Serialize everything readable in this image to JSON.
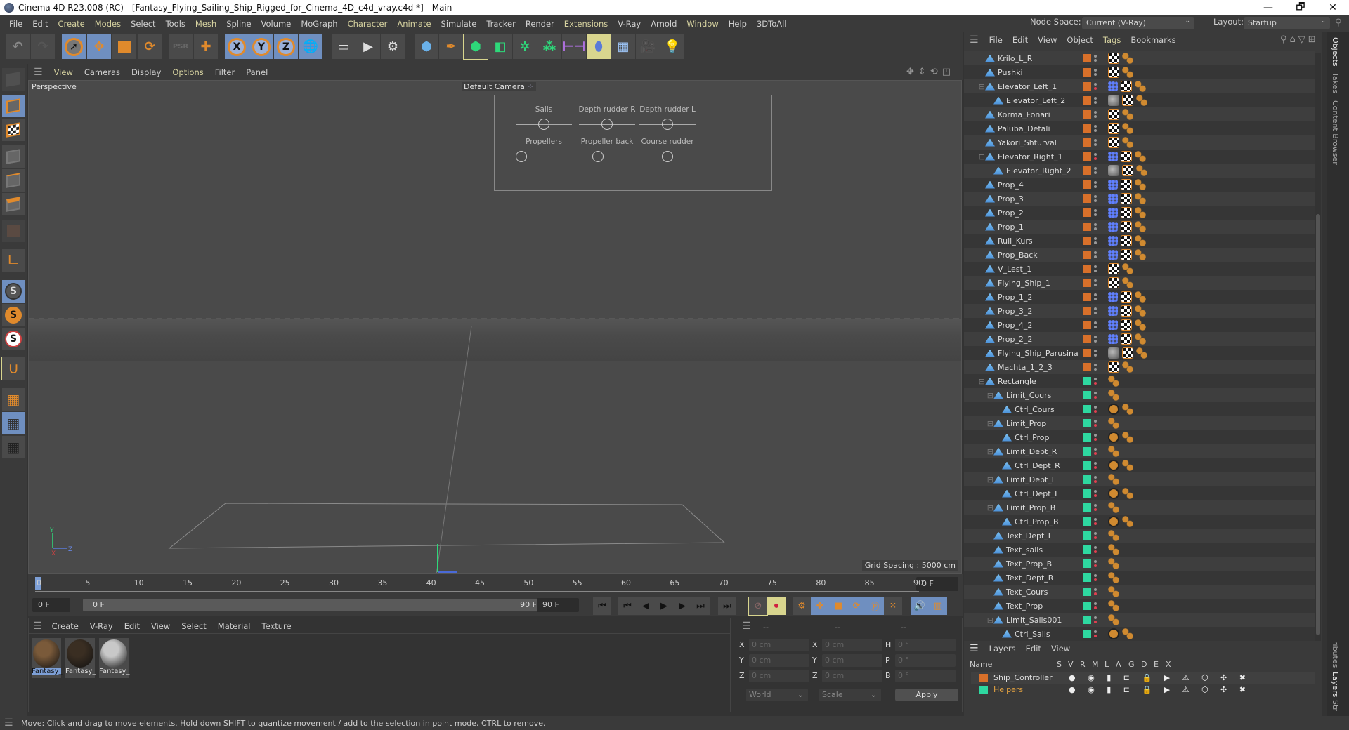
{
  "window": {
    "title": "Cinema 4D R23.008 (RC) - [Fantasy_Flying_Sailing_Ship_Rigged_for_Cinema_4D_c4d_vray.c4d *] - Main",
    "controls": [
      "—",
      "🗗",
      "✕"
    ]
  },
  "menubar": {
    "items": [
      {
        "label": "File",
        "hl": false
      },
      {
        "label": "Edit",
        "hl": false
      },
      {
        "label": "Create",
        "hl": true
      },
      {
        "label": "Modes",
        "hl": true
      },
      {
        "label": "Select",
        "hl": false
      },
      {
        "label": "Tools",
        "hl": false
      },
      {
        "label": "Mesh",
        "hl": true
      },
      {
        "label": "Spline",
        "hl": false
      },
      {
        "label": "Volume",
        "hl": false
      },
      {
        "label": "MoGraph",
        "hl": false
      },
      {
        "label": "Character",
        "hl": true
      },
      {
        "label": "Animate",
        "hl": true
      },
      {
        "label": "Simulate",
        "hl": false
      },
      {
        "label": "Tracker",
        "hl": false
      },
      {
        "label": "Render",
        "hl": false
      },
      {
        "label": "Extensions",
        "hl": true
      },
      {
        "label": "V-Ray",
        "hl": false
      },
      {
        "label": "Arnold",
        "hl": false
      },
      {
        "label": "Window",
        "hl": true
      },
      {
        "label": "Help",
        "hl": false
      },
      {
        "label": "3DToAll",
        "hl": false
      }
    ],
    "node_space_label": "Node Space:",
    "node_space_value": "Current (V-Ray)",
    "layout_label": "Layout:",
    "layout_value": "Startup"
  },
  "toolbar": {
    "icons": [
      "undo-icon",
      "redo-icon",
      "select-icon",
      "move-icon",
      "scale-icon",
      "rotate-icon",
      "psr-icon",
      "add-icon",
      "x-axis-icon",
      "y-axis-icon",
      "z-axis-icon",
      "coordinate-system-icon",
      "render-view-icon",
      "render-icon",
      "render-settings-icon",
      "cube-icon",
      "pen-icon",
      "subdivision-icon",
      "extrude-icon",
      "cloner-icon",
      "array-icon",
      "deformer-icon",
      "field-icon",
      "floor-icon",
      "camera-icon",
      "light-icon"
    ],
    "axis_labels": [
      "X",
      "Y",
      "Z"
    ]
  },
  "viewport": {
    "menu": [
      {
        "label": "View",
        "hl": true
      },
      {
        "label": "Cameras",
        "hl": false
      },
      {
        "label": "Display",
        "hl": false
      },
      {
        "label": "Options",
        "hl": true
      },
      {
        "label": "Filter",
        "hl": false
      },
      {
        "label": "Panel",
        "hl": false
      }
    ],
    "projection": "Perspective",
    "camera": "Default Camera",
    "grid_spacing": "Grid Spacing : 5000 cm",
    "axis": {
      "x": "X",
      "y": "Y",
      "z": "Z"
    },
    "hud_controls": [
      {
        "label": "Sails",
        "value": 0.5
      },
      {
        "label": "Depth rudder R",
        "value": 0.5
      },
      {
        "label": "Depth rudder L",
        "value": 0.5
      },
      {
        "label": "Propellers",
        "value": 0.0
      },
      {
        "label": "Propeller back",
        "value": 0.3
      },
      {
        "label": "Course rudder",
        "value": 0.5
      }
    ]
  },
  "timeline": {
    "ticks": [
      "0",
      "5",
      "10",
      "15",
      "20",
      "25",
      "30",
      "35",
      "40",
      "45",
      "50",
      "55",
      "60",
      "65",
      "70",
      "75",
      "80",
      "85",
      "90"
    ],
    "current_frame": "0 F",
    "start_frame": "0 F",
    "range_start": "0 F",
    "range_end": "90 F",
    "end_frame": "90 F"
  },
  "materials": {
    "menu": [
      "Create",
      "V-Ray",
      "Edit",
      "View",
      "Select",
      "Material",
      "Texture"
    ],
    "items": [
      {
        "name": "Fantasy_",
        "selected": true,
        "color": "#7a5a3a"
      },
      {
        "name": "Fantasy_",
        "selected": false,
        "color": "#3a2e22"
      },
      {
        "name": "Fantasy_",
        "selected": false,
        "color": "#c8c8c8"
      }
    ]
  },
  "coordinates": {
    "headers": [
      "--",
      "--",
      "--"
    ],
    "rows": [
      {
        "a": "X",
        "av": "0 cm",
        "b": "X",
        "bv": "0 cm",
        "c": "H",
        "cv": "0 °"
      },
      {
        "a": "Y",
        "av": "0 cm",
        "b": "Y",
        "bv": "0 cm",
        "c": "P",
        "cv": "0 °"
      },
      {
        "a": "Z",
        "av": "0 cm",
        "b": "Z",
        "bv": "0 cm",
        "c": "B",
        "cv": "0 °"
      }
    ],
    "space": "World",
    "mode": "Scale",
    "apply": "Apply"
  },
  "status": "Move: Click and drag to move elements. Hold down SHIFT to quantize movement / add to the selection in point mode, CTRL to remove.",
  "objects": {
    "menu": [
      {
        "label": "File",
        "hl": false
      },
      {
        "label": "Edit",
        "hl": false
      },
      {
        "label": "View",
        "hl": false
      },
      {
        "label": "Object",
        "hl": false
      },
      {
        "label": "Tags",
        "hl": true
      },
      {
        "label": "Bookmarks",
        "hl": false
      }
    ],
    "rows": [
      {
        "name": "Krilo_L_R",
        "indent": 1,
        "color": "#d8702a",
        "tags": [
          "mat",
          "chk",
          "bul"
        ]
      },
      {
        "name": "Pushki",
        "indent": 1,
        "color": "#d8702a",
        "tags": [
          "mat",
          "chk",
          "bul"
        ]
      },
      {
        "name": "Elevator_Left_1",
        "indent": 1,
        "color": "#d8702a",
        "tags": [
          "ik",
          "mat",
          "chk",
          "bul"
        ],
        "expand": true
      },
      {
        "name": "Elevator_Left_2",
        "indent": 2,
        "color": "#d8702a",
        "tags": [
          "grey",
          "chk",
          "bul"
        ]
      },
      {
        "name": "Korma_Fonari",
        "indent": 1,
        "color": "#d8702a",
        "tags": [
          "mat",
          "chk",
          "bul"
        ]
      },
      {
        "name": "Paluba_Detali",
        "indent": 1,
        "color": "#d8702a",
        "tags": [
          "mat",
          "chk",
          "bul"
        ]
      },
      {
        "name": "Yakori_Shturval",
        "indent": 1,
        "color": "#d8702a",
        "tags": [
          "mat",
          "chk",
          "bul"
        ]
      },
      {
        "name": "Elevator_Right_1",
        "indent": 1,
        "color": "#d8702a",
        "tags": [
          "ik",
          "mat",
          "chk",
          "bul"
        ],
        "expand": true
      },
      {
        "name": "Elevator_Right_2",
        "indent": 2,
        "color": "#d8702a",
        "tags": [
          "grey",
          "chk",
          "bul"
        ]
      },
      {
        "name": "Prop_4",
        "indent": 1,
        "color": "#d8702a",
        "tags": [
          "ik",
          "mat",
          "chk",
          "bul"
        ]
      },
      {
        "name": "Prop_3",
        "indent": 1,
        "color": "#d8702a",
        "tags": [
          "ik",
          "mat",
          "chk",
          "bul"
        ]
      },
      {
        "name": "Prop_2",
        "indent": 1,
        "color": "#d8702a",
        "tags": [
          "ik",
          "mat",
          "chk",
          "bul"
        ]
      },
      {
        "name": "Prop_1",
        "indent": 1,
        "color": "#d8702a",
        "tags": [
          "ik",
          "mat",
          "chk",
          "bul"
        ]
      },
      {
        "name": "Ruli_Kurs",
        "indent": 1,
        "color": "#d8702a",
        "tags": [
          "ik",
          "mat",
          "chk",
          "bul"
        ]
      },
      {
        "name": "Prop_Back",
        "indent": 1,
        "color": "#d8702a",
        "tags": [
          "ik",
          "mat",
          "chk",
          "bul"
        ]
      },
      {
        "name": "V_Lest_1",
        "indent": 1,
        "color": "#d8702a",
        "tags": [
          "mat",
          "chk",
          "bul"
        ]
      },
      {
        "name": "Flying_Ship_1",
        "indent": 1,
        "color": "#d8702a",
        "tags": [
          "mat",
          "chk",
          "bul"
        ]
      },
      {
        "name": "Prop_1_2",
        "indent": 1,
        "color": "#d8702a",
        "tags": [
          "ik",
          "mat",
          "chk",
          "bul"
        ]
      },
      {
        "name": "Prop_3_2",
        "indent": 1,
        "color": "#d8702a",
        "tags": [
          "ik",
          "mat",
          "chk",
          "bul"
        ]
      },
      {
        "name": "Prop_4_2",
        "indent": 1,
        "color": "#d8702a",
        "tags": [
          "ik",
          "mat",
          "chk",
          "bul"
        ]
      },
      {
        "name": "Prop_2_2",
        "indent": 1,
        "color": "#d8702a",
        "tags": [
          "ik",
          "mat",
          "chk",
          "bul"
        ]
      },
      {
        "name": "Flying_Ship_Parusina",
        "indent": 1,
        "color": "#d8702a",
        "tags": [
          "grey",
          "chk",
          "bul"
        ]
      },
      {
        "name": "Machta_1_2_3",
        "indent": 1,
        "color": "#d8702a",
        "tags": [
          "mat",
          "chk",
          "bul"
        ]
      },
      {
        "name": "Rectangle",
        "indent": 1,
        "color": "#2ed8a0",
        "tags": [
          "bul"
        ],
        "expand": true
      },
      {
        "name": "Limit_Cours",
        "indent": 2,
        "color": "#2ed8a0",
        "tags": [
          "bul"
        ],
        "expand": true
      },
      {
        "name": "Ctrl_Cours",
        "indent": 3,
        "color": "#2ed8a0",
        "tags": [
          "no",
          "bul"
        ]
      },
      {
        "name": "Limit_Prop",
        "indent": 2,
        "color": "#2ed8a0",
        "tags": [
          "bul"
        ],
        "expand": true
      },
      {
        "name": "Ctrl_Prop",
        "indent": 3,
        "color": "#2ed8a0",
        "tags": [
          "no",
          "bul"
        ]
      },
      {
        "name": "Limit_Dept_R",
        "indent": 2,
        "color": "#2ed8a0",
        "tags": [
          "bul"
        ],
        "expand": true
      },
      {
        "name": "Ctrl_Dept_R",
        "indent": 3,
        "color": "#2ed8a0",
        "tags": [
          "no",
          "bul"
        ]
      },
      {
        "name": "Limit_Dept_L",
        "indent": 2,
        "color": "#2ed8a0",
        "tags": [
          "bul"
        ],
        "expand": true
      },
      {
        "name": "Ctrl_Dept_L",
        "indent": 3,
        "color": "#2ed8a0",
        "tags": [
          "no",
          "bul"
        ]
      },
      {
        "name": "Limit_Prop_B",
        "indent": 2,
        "color": "#2ed8a0",
        "tags": [
          "bul"
        ],
        "expand": true
      },
      {
        "name": "Ctrl_Prop_B",
        "indent": 3,
        "color": "#2ed8a0",
        "tags": [
          "no",
          "bul"
        ]
      },
      {
        "name": "Text_Dept_L",
        "indent": 2,
        "color": "#2ed8a0",
        "tags": [
          "bul"
        ]
      },
      {
        "name": "Text_sails",
        "indent": 2,
        "color": "#2ed8a0",
        "tags": [
          "bul"
        ]
      },
      {
        "name": "Text_Prop_B",
        "indent": 2,
        "color": "#2ed8a0",
        "tags": [
          "bul"
        ]
      },
      {
        "name": "Text_Dept_R",
        "indent": 2,
        "color": "#2ed8a0",
        "tags": [
          "bul"
        ]
      },
      {
        "name": "Text_Cours",
        "indent": 2,
        "color": "#2ed8a0",
        "tags": [
          "bul"
        ]
      },
      {
        "name": "Text_Prop",
        "indent": 2,
        "color": "#2ed8a0",
        "tags": [
          "bul"
        ]
      },
      {
        "name": "Limit_Sails001",
        "indent": 2,
        "color": "#2ed8a0",
        "tags": [
          "bul"
        ],
        "expand": true
      },
      {
        "name": "Ctrl_Sails",
        "indent": 3,
        "color": "#2ed8a0",
        "tags": [
          "no",
          "bul"
        ]
      }
    ]
  },
  "side_tabs": [
    "Objects",
    "Takes",
    "Content Browser",
    "ributes",
    "Layers",
    "Str"
  ],
  "layers": {
    "menu": [
      "Layers",
      "Edit",
      "View"
    ],
    "columns": [
      "Name",
      "S",
      "V",
      "R",
      "M",
      "L",
      "A",
      "G",
      "D",
      "E",
      "X"
    ],
    "rows": [
      {
        "name": "Ship_Controller",
        "color": "#d8702a",
        "text_color": "#dddddd"
      },
      {
        "name": "Helpers",
        "color": "#2ed8a0",
        "text_color": "#e0a040"
      }
    ]
  }
}
